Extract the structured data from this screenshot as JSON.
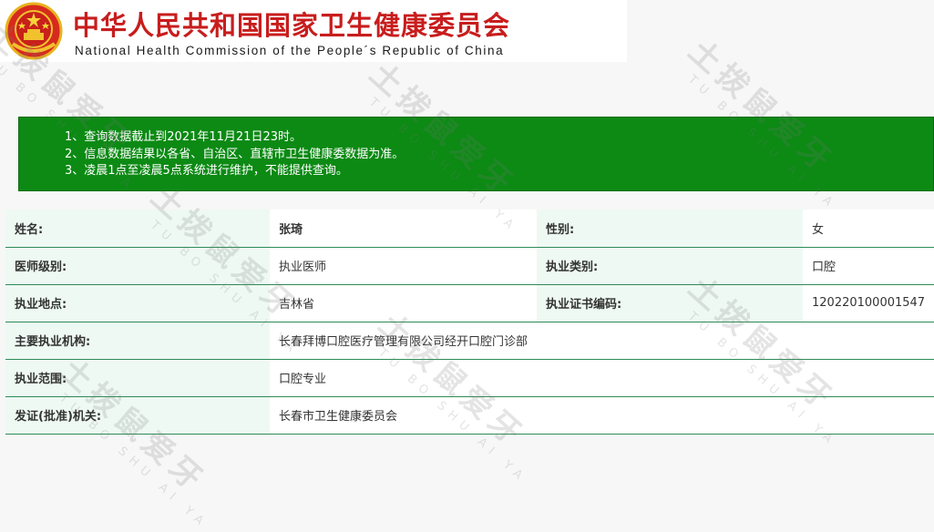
{
  "header": {
    "title_cn": "中华人民共和国国家卫生健康委员会",
    "title_en": "National Health Commission of the People´s Republic of China",
    "emblem_icon": "national-emblem-icon"
  },
  "notice": {
    "items": [
      "1、查询数据截止到2021年11月21日23时。",
      "2、信息数据结果以各省、自治区、直辖市卫生健康委数据为准。",
      "3、凌晨1点至凌晨5点系统进行维护，不能提供查询。"
    ],
    "background": "#0c8a14"
  },
  "record": {
    "name_label": "姓名:",
    "name_value": "张琦",
    "gender_label": "性别:",
    "gender_value": "女",
    "level_label": "医师级别:",
    "level_value": "执业医师",
    "category_label": "执业类别:",
    "category_value": "口腔",
    "location_label": "执业地点:",
    "location_value": "吉林省",
    "cert_label": "执业证书编码:",
    "cert_value": "120220100001547",
    "institution_label": "主要执业机构:",
    "institution_value": "长春拜博口腔医疗管理有限公司经开口腔门诊部",
    "scope_label": "执业范围:",
    "scope_value": "口腔专业",
    "issuer_label": "发证(批准)机关:",
    "issuer_value": "长春市卫生健康委员会"
  },
  "watermark": {
    "text_cn": "土拨鼠爱牙",
    "text_en": "TU BO SHU AI YA"
  },
  "colors": {
    "title_red": "#c81d1d",
    "label_bg": "#eef9f3",
    "row_border": "#2e8b57"
  }
}
